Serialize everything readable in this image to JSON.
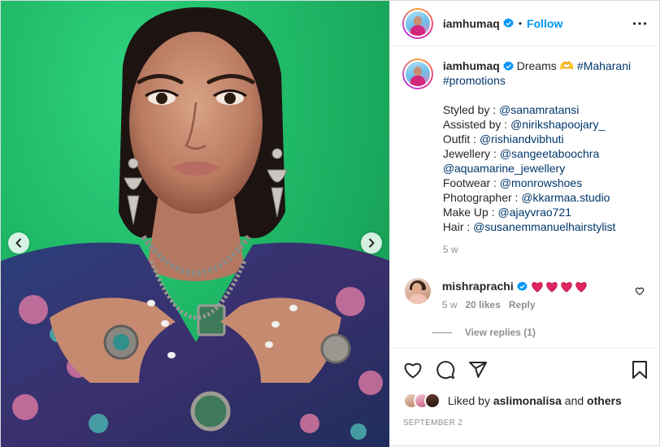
{
  "header": {
    "username": "iamhumaq",
    "separator": "•",
    "follow_label": "Follow"
  },
  "caption": {
    "username": "iamhumaq",
    "first_text": "Dreams 🫶",
    "hashtags": [
      "#Maharani",
      "#promotions"
    ],
    "credits": [
      {
        "label": "Styled by : ",
        "handle": "@sanamratansi"
      },
      {
        "label": "Assisted by : ",
        "handle": "@nirikshapoojary_"
      },
      {
        "label": "Outfit : ",
        "handle": "@rishiandvibhuti"
      },
      {
        "label": "Jewellery : ",
        "handle": "@sangeetaboochra"
      },
      {
        "label": "",
        "handle": "@aquamarine_jewellery"
      },
      {
        "label": "Footwear : ",
        "handle": "@monrowshoes"
      },
      {
        "label": "Photographer : ",
        "handle": "@kkarmaa.studio"
      },
      {
        "label": "Make Up : ",
        "handle": "@ajayvrao721"
      },
      {
        "label": "Hair : ",
        "handle": "@susanemmanuelhairstylist"
      }
    ],
    "time_ago": "5 w"
  },
  "comment": {
    "username": "mishraprachi",
    "time_ago": "5 w",
    "likes": "20 likes",
    "reply_label": "Reply",
    "view_replies": "View replies (1)"
  },
  "likes_summary": {
    "prefix": "Liked by ",
    "user": "aslimonalisa",
    "connector": " and ",
    "others": "others"
  },
  "date": "SEPTEMBER 2",
  "colors": {
    "link": "#00376b",
    "follow": "#0095f6",
    "verified": "#0095f6",
    "heart_emoji": "#e0245e",
    "backdrop_green": "#1fb867"
  },
  "icons": [
    "verified-badge-icon",
    "more-options-icon",
    "chevron-left-icon",
    "chevron-right-icon",
    "heart-icon",
    "comment-icon",
    "share-icon",
    "bookmark-icon"
  ]
}
